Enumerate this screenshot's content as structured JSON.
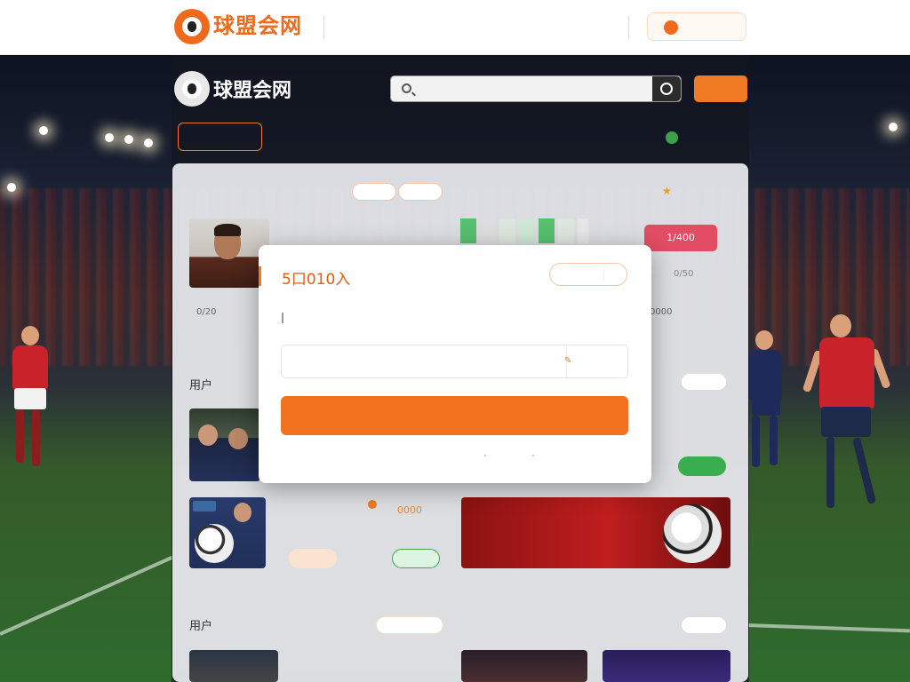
{
  "top_header": {
    "brand_name": "球盟会网",
    "brand_sub": "",
    "nav": [
      "",
      "",
      "",
      "",
      ""
    ],
    "cta_label": ""
  },
  "inner_header": {
    "brand_name": "球盟会网",
    "brand_sub": "",
    "search_placeholder": "",
    "action_button": "",
    "nav_active": "",
    "nav": [
      "",
      "",
      "",
      "",
      ""
    ],
    "nav_right": ""
  },
  "content": {
    "section1": {
      "title": "",
      "pill_a": "",
      "pill_b": "",
      "more": "",
      "headline": "",
      "left_number": "0/20",
      "right_number": "0000",
      "red_button": "1/400",
      "right_value": "0/50"
    },
    "section2": {
      "title": "用户",
      "list": [
        {
          "title": "",
          "metric": "0000",
          "btn_primary": ""
        },
        {
          "title": "",
          "metric": "",
          "btn_secondary": ""
        }
      ],
      "promo_line1": "",
      "promo_line2": ""
    },
    "section3": {
      "title": "用户",
      "item_title": ""
    }
  },
  "login_modal": {
    "title": "5口010入",
    "pill_label": "",
    "pill_close": "",
    "description": "",
    "phone_placeholder": "",
    "code_button": "",
    "submit_label": "",
    "links": [
      "",
      "",
      "",
      "",
      ""
    ]
  },
  "colors": {
    "brand_orange": "#f2721f",
    "accent_red": "#e24d63",
    "accent_green": "#3aae4f"
  },
  "icons": [
    "logo-icon",
    "search-icon",
    "lock-icon",
    "phone-icon",
    "star-icon"
  ]
}
